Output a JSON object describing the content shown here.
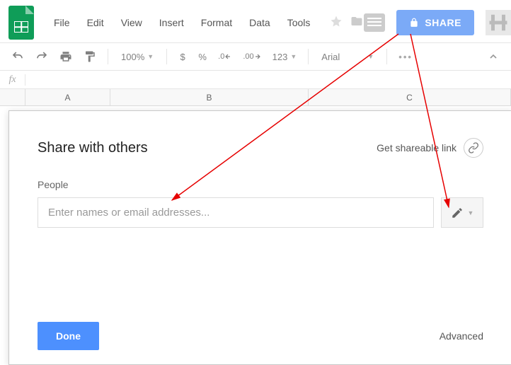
{
  "header": {
    "menus": [
      "File",
      "Edit",
      "View",
      "Insert",
      "Format",
      "Data",
      "Tools"
    ],
    "share_label": "SHARE"
  },
  "toolbar": {
    "zoom": "100%",
    "currency": "$",
    "percent": "%",
    "dec_dec": ".0",
    "dec_inc": ".00",
    "numfmt": "123",
    "font": "Arial"
  },
  "columns": {
    "A": "A",
    "B": "B",
    "C": "C"
  },
  "dialog": {
    "title": "Share with others",
    "get_link": "Get shareable link",
    "people_label": "People",
    "input_placeholder": "Enter names or email addresses...",
    "done": "Done",
    "advanced": "Advanced"
  }
}
